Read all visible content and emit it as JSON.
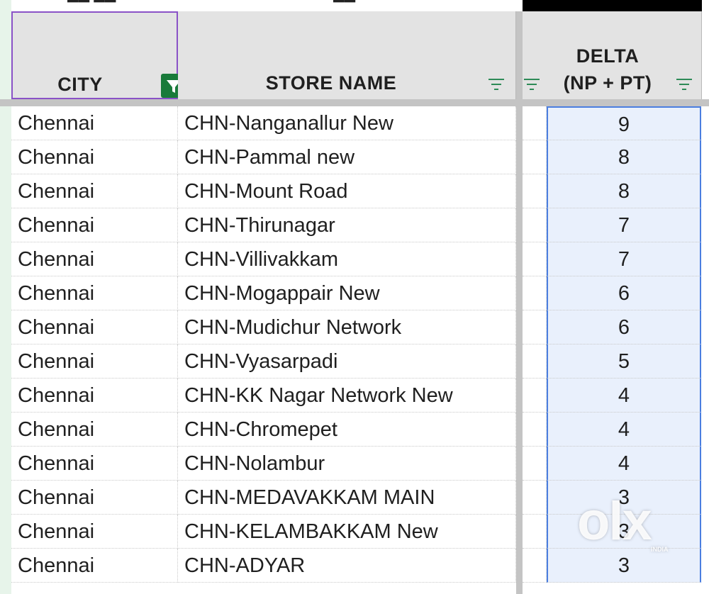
{
  "top_fragments": [
    "ϟϟ ϟϟ",
    "ϟϟ",
    "ϟϟ"
  ],
  "headers": {
    "city": "CITY",
    "store_name": "STORE NAME",
    "delta_line1": "DELTA",
    "delta_line2": "(NP + PT)"
  },
  "colors": {
    "header_bg": "#e3e3e3",
    "filter_active": "#197a3a",
    "filter_icon": "#2e8b57",
    "selection_border": "#4a7ee0",
    "selection_fill": "#e9f0fc",
    "column_select": "#8a52c7",
    "row_stub": "#e7f4ea"
  },
  "rows": [
    {
      "city": "Chennai",
      "store": "CHN-Nanganallur New",
      "delta": "9"
    },
    {
      "city": "Chennai",
      "store": "CHN-Pammal new",
      "delta": "8"
    },
    {
      "city": "Chennai",
      "store": "CHN-Mount Road",
      "delta": "8"
    },
    {
      "city": "Chennai",
      "store": "CHN-Thirunagar",
      "delta": "7"
    },
    {
      "city": "Chennai",
      "store": "CHN-Villivakkam",
      "delta": "7"
    },
    {
      "city": "Chennai",
      "store": "CHN-Mogappair New",
      "delta": "6"
    },
    {
      "city": "Chennai",
      "store": "CHN-Mudichur Network",
      "delta": "6"
    },
    {
      "city": "Chennai",
      "store": "CHN-Vyasarpadi",
      "delta": "5"
    },
    {
      "city": "Chennai",
      "store": "CHN-KK Nagar Network New",
      "delta": "4"
    },
    {
      "city": "Chennai",
      "store": "CHN-Chromepet",
      "delta": "4"
    },
    {
      "city": "Chennai",
      "store": "CHN-Nolambur",
      "delta": "4"
    },
    {
      "city": "Chennai",
      "store": "CHN-MEDAVAKKAM MAIN",
      "delta": "3"
    },
    {
      "city": "Chennai",
      "store": "CHN-KELAMBAKKAM New",
      "delta": "3"
    },
    {
      "city": "Chennai",
      "store": "CHN-ADYAR",
      "delta": "3"
    }
  ],
  "watermark": {
    "brand": "olx",
    "sub": "INDIA"
  }
}
